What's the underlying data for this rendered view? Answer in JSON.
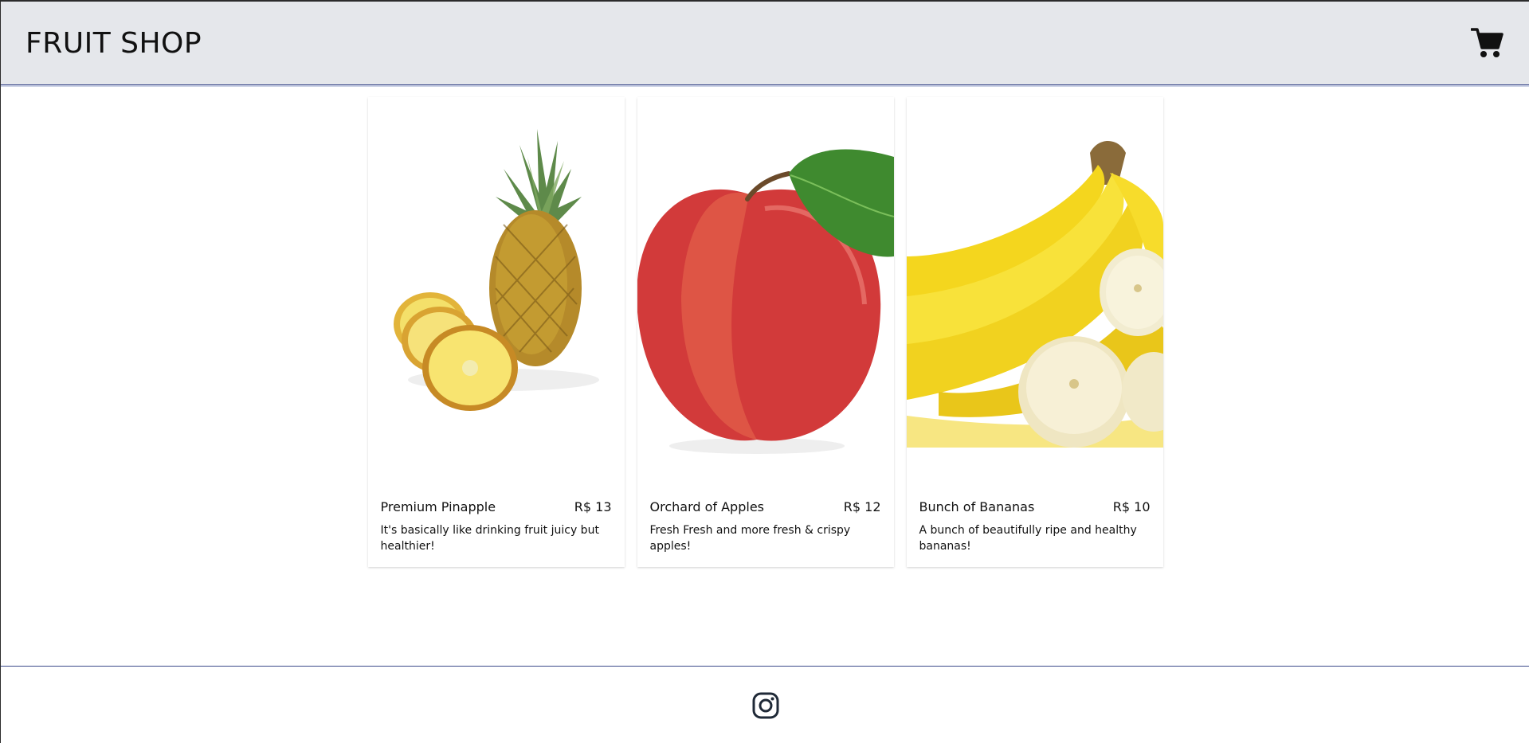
{
  "header": {
    "brand": "FRUIT SHOP",
    "cart_icon": "cart-icon"
  },
  "products": [
    {
      "name": "Premium Pinapple",
      "price": "R$ 13",
      "description": "It's basically like drinking fruit juicy but healthier!",
      "image": "pineapple"
    },
    {
      "name": "Orchard of Apples",
      "price": "R$ 12",
      "description": "Fresh Fresh and more fresh & crispy apples!",
      "image": "apple"
    },
    {
      "name": "Bunch of Bananas",
      "price": "R$ 10",
      "description": "A bunch of beautifully ripe and healthy bananas!",
      "image": "bananas"
    }
  ],
  "footer": {
    "social_icon": "instagram-icon"
  },
  "colors": {
    "header_bg": "#e5e7eb",
    "border_accent": "#3b4a8a"
  }
}
